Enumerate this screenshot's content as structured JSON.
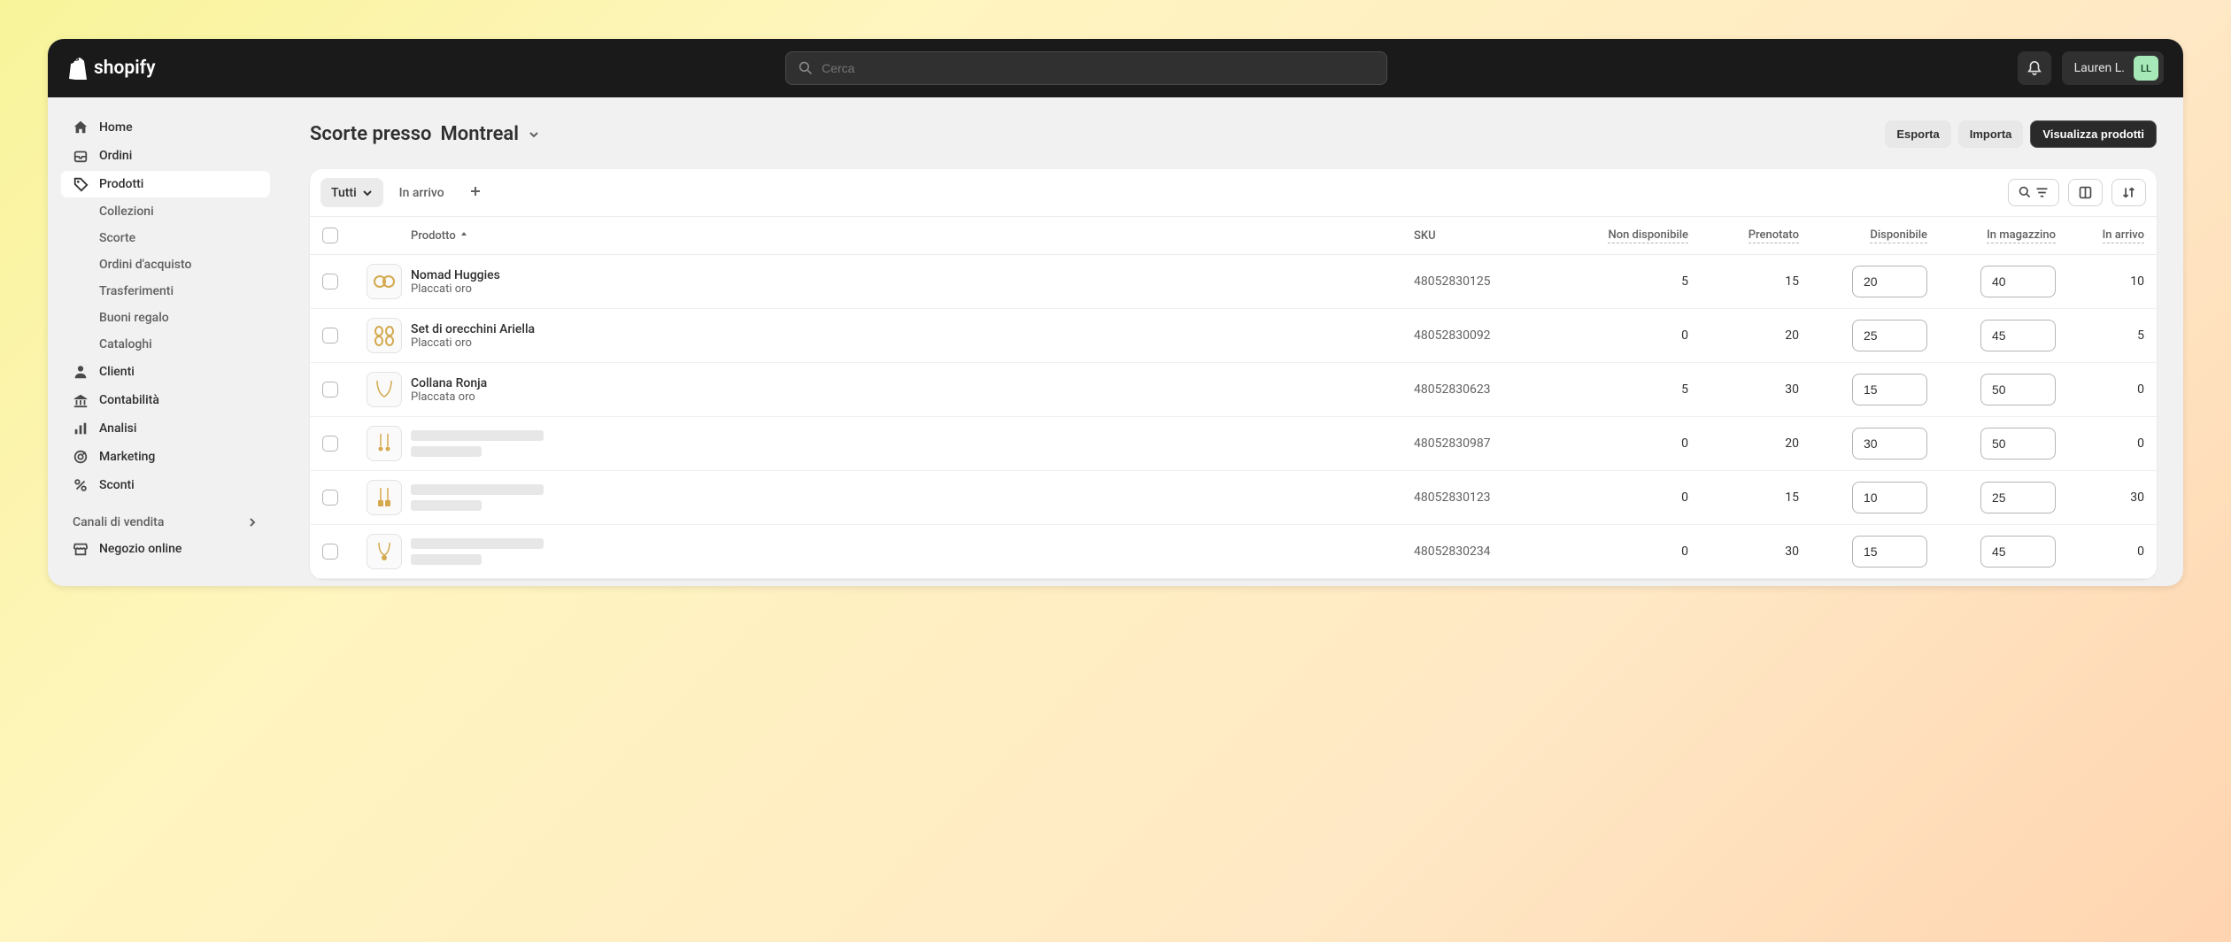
{
  "brand": "shopify",
  "search": {
    "placeholder": "Cerca"
  },
  "user": {
    "name": "Lauren L.",
    "initials": "LL"
  },
  "nav": {
    "home": "Home",
    "orders": "Ordini",
    "products": "Prodotti",
    "collections": "Collezioni",
    "inventory": "Scorte",
    "purchase_orders": "Ordini d'acquisto",
    "transfers": "Trasferimenti",
    "gift_cards": "Buoni regalo",
    "catalogs": "Cataloghi",
    "customers": "Clienti",
    "finances": "Contabilità",
    "analytics": "Analisi",
    "marketing": "Marketing",
    "discounts": "Sconti",
    "channels_header": "Canali di vendita",
    "online_store": "Negozio online"
  },
  "page": {
    "title_prefix": "Scorte presso",
    "location": "Montreal"
  },
  "actions": {
    "export": "Esporta",
    "import": "Importa",
    "view_products": "Visualizza prodotti"
  },
  "tabs": {
    "all": "Tutti",
    "incoming": "In arrivo"
  },
  "columns": {
    "product": "Prodotto",
    "sku": "SKU",
    "unavailable": "Non disponibile",
    "committed": "Prenotato",
    "available": "Disponibile",
    "on_hand": "In magazzino",
    "incoming": "In arrivo"
  },
  "rows": [
    {
      "name": "Nomad Huggies",
      "variant": "Placcati oro",
      "sku": "48052830125",
      "unavailable": "5",
      "committed": "15",
      "available": "20",
      "on_hand": "40",
      "incoming": "10",
      "skeleton": false
    },
    {
      "name": "Set di orecchini Ariella",
      "variant": "Placcati oro",
      "sku": "48052830092",
      "unavailable": "0",
      "committed": "20",
      "available": "25",
      "on_hand": "45",
      "incoming": "5",
      "skeleton": false
    },
    {
      "name": "Collana Ronja",
      "variant": "Placcata oro",
      "sku": "48052830623",
      "unavailable": "5",
      "committed": "30",
      "available": "15",
      "on_hand": "50",
      "incoming": "0",
      "skeleton": false
    },
    {
      "name": "",
      "variant": "",
      "sku": "48052830987",
      "unavailable": "0",
      "committed": "20",
      "available": "30",
      "on_hand": "50",
      "incoming": "0",
      "skeleton": true
    },
    {
      "name": "",
      "variant": "",
      "sku": "48052830123",
      "unavailable": "0",
      "committed": "15",
      "available": "10",
      "on_hand": "25",
      "incoming": "30",
      "skeleton": true
    },
    {
      "name": "",
      "variant": "",
      "sku": "48052830234",
      "unavailable": "0",
      "committed": "30",
      "available": "15",
      "on_hand": "45",
      "incoming": "0",
      "skeleton": true
    }
  ]
}
